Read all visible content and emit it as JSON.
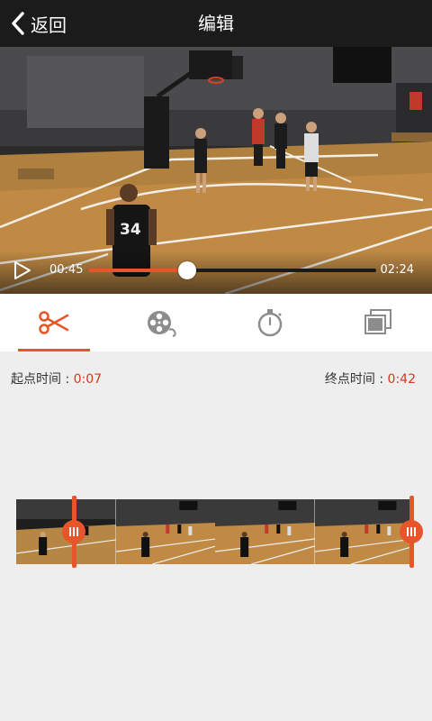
{
  "header": {
    "back_label": "返回",
    "title": "编辑"
  },
  "player": {
    "current_time": "00:45",
    "total_time": "02:24",
    "progress": 0.345,
    "jersey_number": "34"
  },
  "tabs": [
    {
      "icon": "scissors-icon",
      "active": true
    },
    {
      "icon": "film-reel-icon",
      "active": false
    },
    {
      "icon": "stopwatch-icon",
      "active": false
    },
    {
      "icon": "photo-stack-icon",
      "active": false
    }
  ],
  "trim": {
    "start_label": "起点时间 :",
    "start_value": "0:07",
    "end_label": "终点时间 :",
    "end_value": "0:42"
  },
  "colors": {
    "accent": "#e8552a",
    "time_value": "#d8361d",
    "header_bg": "#1b1b1b"
  }
}
